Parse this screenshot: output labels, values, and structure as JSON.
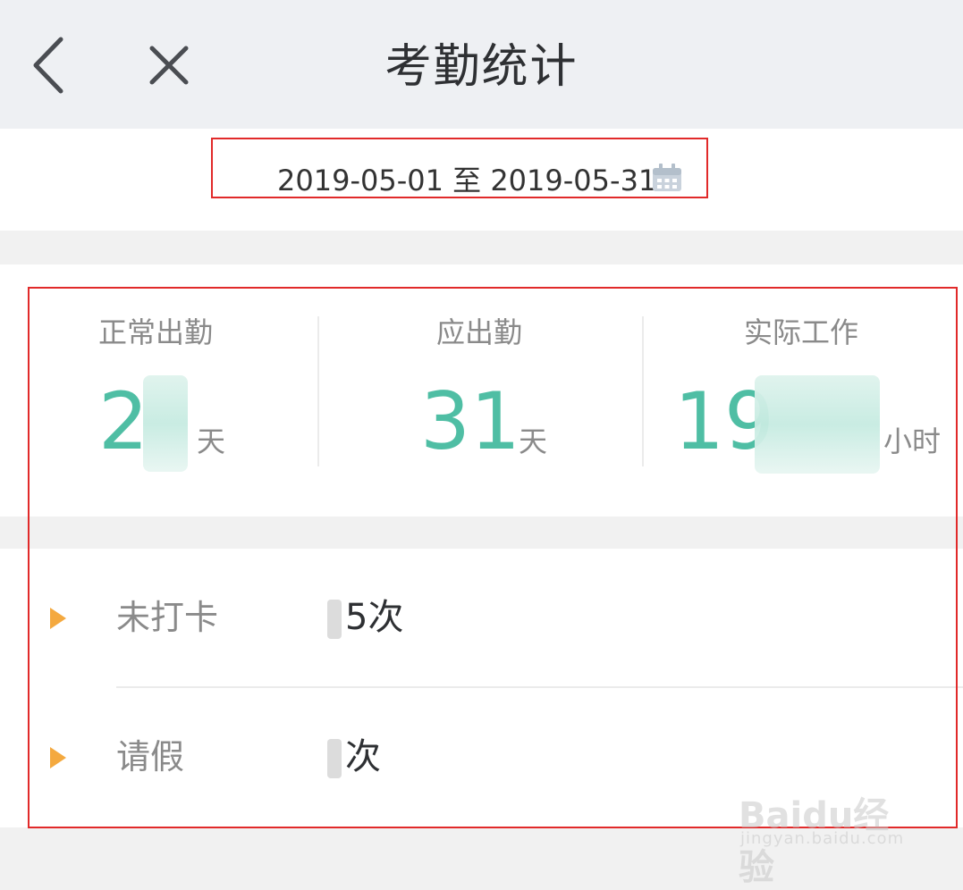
{
  "header": {
    "title": "考勤统计"
  },
  "date_range": {
    "text": "2019-05-01 至 2019-05-31"
  },
  "stats": [
    {
      "label": "正常出勤",
      "value": "2",
      "unit": "天"
    },
    {
      "label": "应出勤",
      "value": "31",
      "unit": "天"
    },
    {
      "label": "实际工作",
      "value": "19",
      "unit": "小时"
    }
  ],
  "list": [
    {
      "label": "未打卡",
      "value": "5次"
    },
    {
      "label": "请假",
      "value": "次"
    }
  ],
  "watermark": {
    "logo": "Baidu经验",
    "url": "jingyan.baidu.com"
  },
  "colors": {
    "accent": "#4fbea4",
    "arrow": "#f4a93f",
    "highlight_border": "#e12a2a",
    "header_bg": "#eef0f3"
  }
}
